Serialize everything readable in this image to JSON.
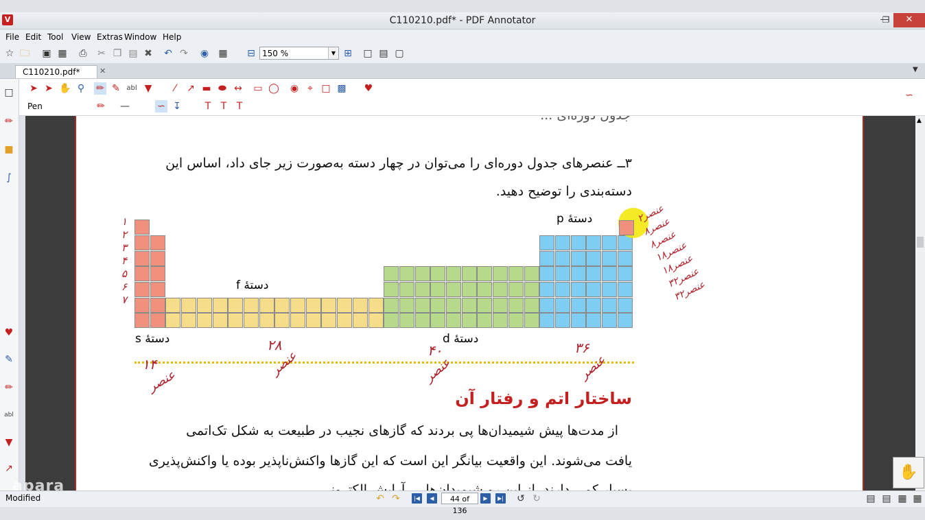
{
  "window": {
    "title": "C110210.pdf* - PDF Annotator",
    "logo": "V"
  },
  "menu": [
    "File",
    "Edit",
    "Tool",
    "View",
    "Extras",
    "Window",
    "Help"
  ],
  "toolbar": {
    "zoom": "150 %"
  },
  "tab": {
    "label": "C110210.pdf*"
  },
  "penbar": {
    "label": "Pen"
  },
  "document": {
    "prev_line": "جدول دوره‌ای ... ",
    "question_line1": "۳ــ عنصرهای جدول دوره‌ای را  می‌توان در چهار دسته به‌صورت زیر جای داد، اساس این",
    "question_line2": "دسته‌بندی را توضیح دهید.",
    "block_s": "دستهٔ s",
    "block_p": "دستهٔ p",
    "block_d": "دستهٔ d",
    "block_f": "دستهٔ f",
    "section_heading": "ساختار اتم و رفتار آن",
    "para_line1": "از مدت‌ها پیش شیمیدان‌ها پی بردند که گازهای نجیب در طبیعت به شکل تک‌اتمی",
    "para_line2": "یافت می‌شوند. این واقعیت بیانگر این است که این گازها واکنش‌ناپذیر بوده یا واکنش‌پذیری",
    "para_line3": "بسیار کمی دارند. از این رو شیمیدان‌ها ... آرایش الکترونی ... ",
    "annotations": {
      "s_count": "۱۴",
      "s_word": "عنصر",
      "f_count": "۲۸",
      "f_word": "عنصر",
      "d_count": "۴۰",
      "d_word": "عنصر",
      "p_count": "۳۶",
      "p_word": "عنصر",
      "row_counts_left": [
        "۱",
        "۲",
        "۳",
        "۴",
        "۵",
        "۶",
        "۷"
      ],
      "row_counts_right": [
        "۲عنصر",
        "۸عنصر",
        "۸عنصر",
        "۱۸عنصر",
        "۱۸عنصر",
        "۳۲عنصر",
        "۳۲عنصر"
      ]
    },
    "colors": {
      "s": "#f0917e",
      "f": "#f6dd8a",
      "d": "#b6d98c",
      "p": "#7fcdf3",
      "annotation": "#b0202a"
    }
  },
  "status": {
    "text": "Modified",
    "page": "44 of 136"
  },
  "watermark": "apara"
}
